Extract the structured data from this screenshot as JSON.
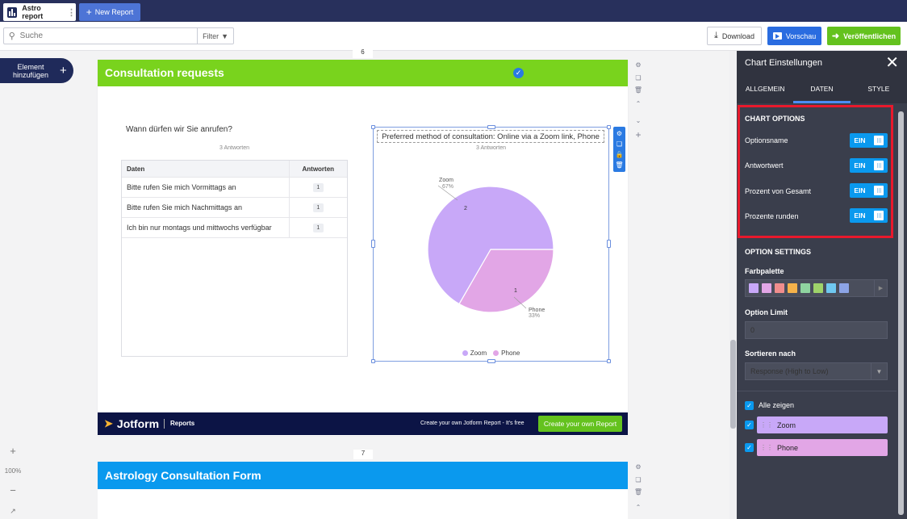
{
  "topbar": {
    "tab_active_label": "Astro report",
    "tab_new_label": "New Report"
  },
  "toolbar": {
    "search_placeholder": "Suche",
    "filter_label": "Filter",
    "download_label": "Download",
    "preview_label": "Vorschau",
    "publish_label": "Veröffentlichen"
  },
  "left": {
    "add_element_label_line1": "Element",
    "add_element_label_line2": "hinzufügen",
    "zoom_level": "100%"
  },
  "page1": {
    "page_number": "6",
    "header_title": "Consultation requests",
    "question": "Wann dürfen wir Sie anrufen?",
    "answer_count": "3 Antworten",
    "table": {
      "headers": [
        "Daten",
        "Antworten"
      ],
      "rows": [
        {
          "label": "Bitte rufen Sie mich Vormittags an",
          "count": "1"
        },
        {
          "label": "Bitte rufen Sie mich Nachmittags an",
          "count": "1"
        },
        {
          "label": "Ich bin nur montags und mittwochs verfügbar",
          "count": "1"
        }
      ]
    }
  },
  "chart": {
    "title": "Preferred method of consultation: Online via a Zoom link, Phone",
    "count": "3 Antworten",
    "label_zoom_name": "Zoom",
    "label_zoom_pct": "67%",
    "label_phone_name": "Phone",
    "label_phone_pct": "33%",
    "value_zoom": "2",
    "value_phone": "1",
    "legend_zoom": "Zoom",
    "legend_phone": "Phone"
  },
  "chart_data": {
    "type": "pie",
    "title": "Preferred method of consultation: Online via a Zoom link, Phone",
    "categories": [
      "Zoom",
      "Phone"
    ],
    "values": [
      2,
      1
    ],
    "percentages": [
      67,
      33
    ],
    "colors": [
      "#c8a8f8",
      "#e2a6e6"
    ],
    "legend": "bottom"
  },
  "footer": {
    "brand": "Jotform",
    "product": "Reports",
    "promo": "Create your own Jotform Report - It's free",
    "cta": "Create your own Report"
  },
  "page2": {
    "page_number": "7",
    "header_title": "Astrology Consultation Form"
  },
  "panel": {
    "title": "Chart Einstellungen",
    "tabs": [
      "ALLGEMEIN",
      "DATEN",
      "STYLE"
    ],
    "active_tab": "DATEN",
    "chart_options_title": "CHART OPTIONS",
    "chart_options": [
      {
        "label": "Optionsname",
        "state": "EIN"
      },
      {
        "label": "Antwortwert",
        "state": "EIN"
      },
      {
        "label": "Prozent von Gesamt",
        "state": "EIN"
      },
      {
        "label": "Prozente runden",
        "state": "EIN"
      }
    ],
    "option_settings_title": "OPTION SETTINGS",
    "palette_label": "Farbpalette",
    "palette_colors": [
      "#c8a8f8",
      "#e2a6e6",
      "#f08d8d",
      "#f5b24a",
      "#8fd4a0",
      "#9fd36a",
      "#6fc8f0",
      "#8ca4e6"
    ],
    "option_limit_label": "Option Limit",
    "option_limit_value": "0",
    "sort_label": "Sortieren nach",
    "sort_value": "Response (High to Low)",
    "show_all_label": "Alle zeigen",
    "options": [
      {
        "label": "Zoom",
        "color": "#c8a8f8"
      },
      {
        "label": "Phone",
        "color": "#e2a6e6"
      }
    ]
  }
}
